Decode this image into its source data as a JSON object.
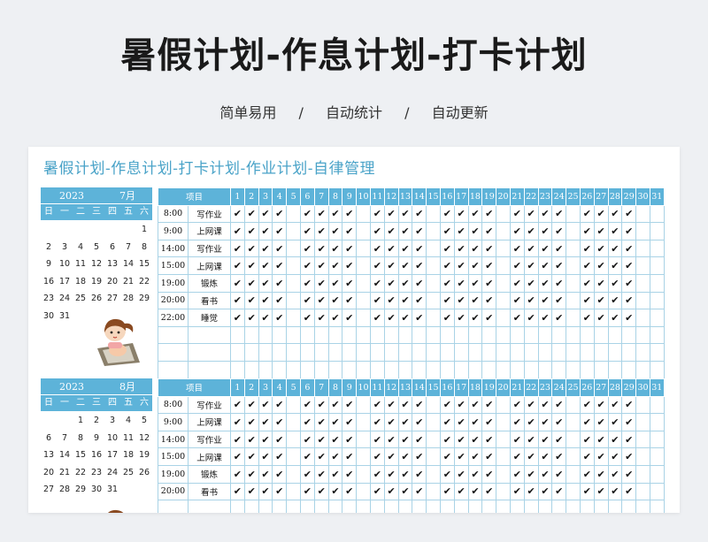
{
  "header": {
    "title": "暑假计划-作息计划-打卡计划",
    "tags": [
      "简单易用",
      "自动统计",
      "自动更新"
    ],
    "separator": "/"
  },
  "sheet": {
    "title": "暑假计划-作息计划-打卡计划-作业计划-自律管理",
    "weekdays": [
      "日",
      "一",
      "二",
      "三",
      "四",
      "五",
      "六"
    ],
    "column_header": "项目",
    "days": [
      "1",
      "2",
      "3",
      "4",
      "5",
      "6",
      "7",
      "8",
      "9",
      "10",
      "11",
      "12",
      "13",
      "14",
      "15",
      "16",
      "17",
      "18",
      "19",
      "20",
      "21",
      "22",
      "23",
      "24",
      "25",
      "26",
      "27",
      "28",
      "29",
      "30",
      "31"
    ],
    "check_mark": "✔",
    "check_days": [
      1,
      2,
      3,
      4,
      6,
      7,
      8,
      9,
      11,
      12,
      13,
      14,
      16,
      17,
      18,
      19,
      21,
      22,
      23,
      24,
      26,
      27,
      28,
      29
    ],
    "colors": {
      "accent": "#5db3d9",
      "title": "#4aa3c8",
      "grid": "#a9d3e6"
    }
  },
  "months": [
    {
      "year": "2023",
      "month": "7月",
      "calendar": [
        "",
        "",
        "",
        "",
        "",
        "",
        "1",
        "2",
        "3",
        "4",
        "5",
        "6",
        "7",
        "8",
        "9",
        "10",
        "11",
        "12",
        "13",
        "14",
        "15",
        "16",
        "17",
        "18",
        "19",
        "20",
        "21",
        "22",
        "23",
        "24",
        "25",
        "26",
        "27",
        "28",
        "29",
        "30",
        "31"
      ],
      "rows": [
        {
          "time": "8:00",
          "item": "写作业"
        },
        {
          "time": "9:00",
          "item": "上网课"
        },
        {
          "time": "14:00",
          "item": "写作业"
        },
        {
          "time": "15:00",
          "item": "上网课"
        },
        {
          "time": "19:00",
          "item": "锻炼"
        },
        {
          "time": "20:00",
          "item": "看书"
        },
        {
          "time": "22:00",
          "item": "睡觉"
        },
        {
          "time": "",
          "item": ""
        },
        {
          "time": "",
          "item": ""
        },
        {
          "time": "",
          "item": ""
        }
      ]
    },
    {
      "year": "2023",
      "month": "8月",
      "calendar": [
        "",
        "",
        "1",
        "2",
        "3",
        "4",
        "5",
        "6",
        "7",
        "8",
        "9",
        "10",
        "11",
        "12",
        "13",
        "14",
        "15",
        "16",
        "17",
        "18",
        "19",
        "20",
        "21",
        "22",
        "23",
        "24",
        "25",
        "26",
        "27",
        "28",
        "29",
        "30",
        "31"
      ],
      "rows": [
        {
          "time": "8:00",
          "item": "写作业"
        },
        {
          "time": "9:00",
          "item": "上网课"
        },
        {
          "time": "14:00",
          "item": "写作业"
        },
        {
          "time": "15:00",
          "item": "上网课"
        },
        {
          "time": "19:00",
          "item": "锻炼"
        },
        {
          "time": "20:00",
          "item": "看书"
        },
        {
          "time": "",
          "item": ""
        }
      ]
    }
  ]
}
